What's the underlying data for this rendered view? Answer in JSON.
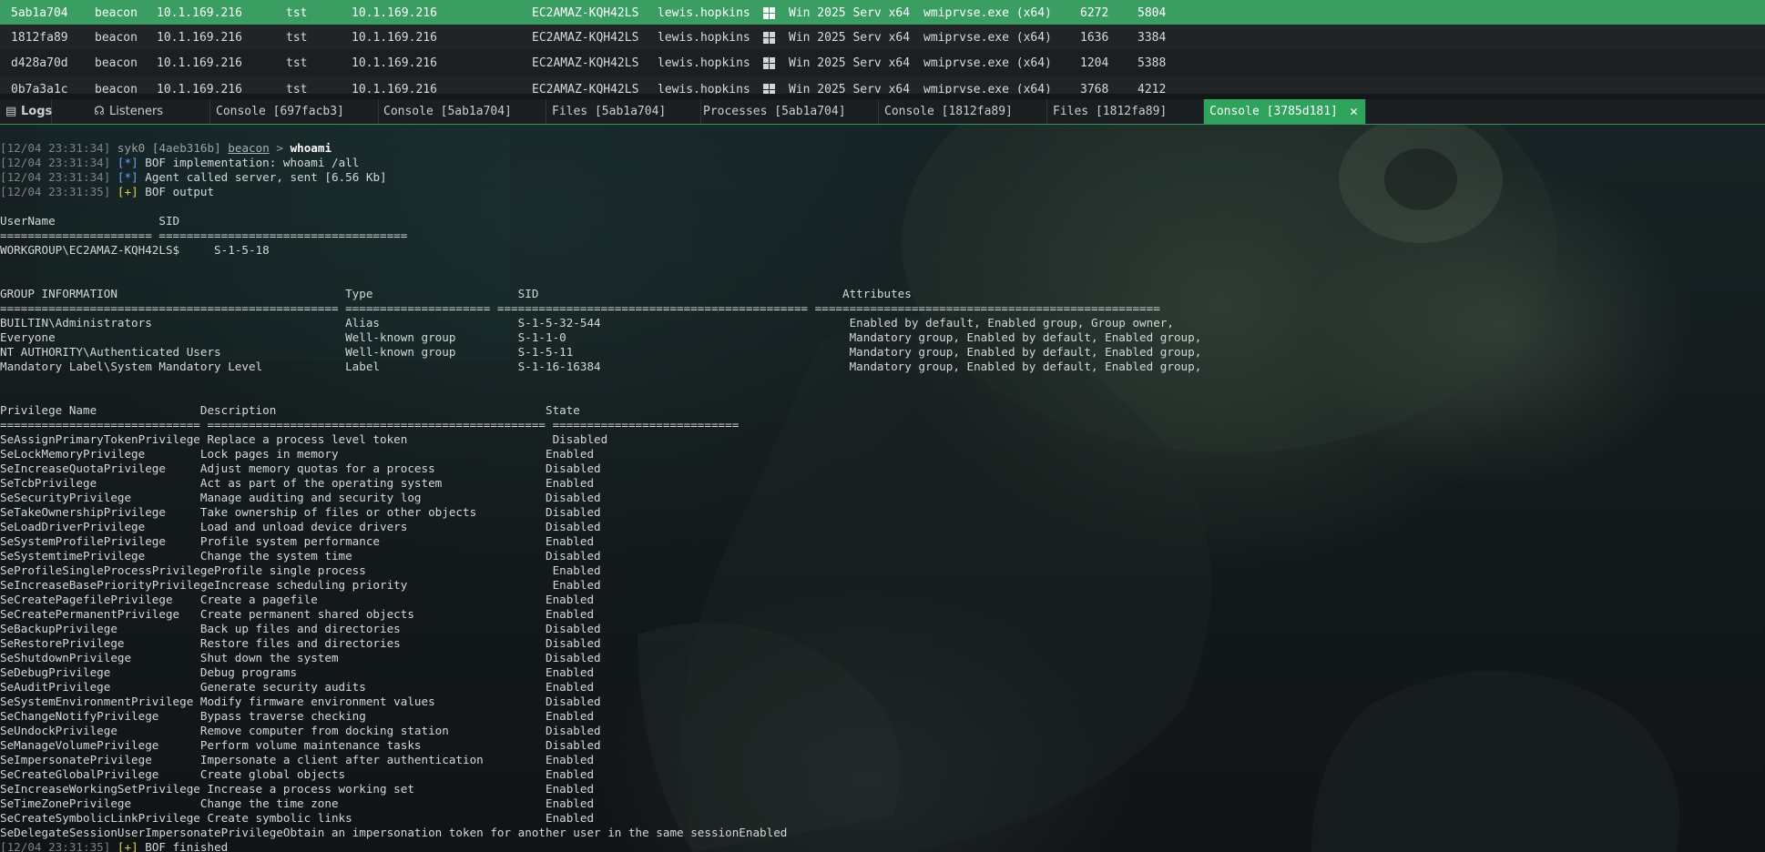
{
  "sessions": [
    {
      "id": "5ab1a704",
      "type": "beacon",
      "external": "10.1.169.216",
      "user": "tst",
      "internal": "10.1.169.216",
      "computer": "EC2AMAZ-KQH42LS",
      "username": "lewis.hopkins",
      "os_icon": "windows-icon",
      "os": "Win 2025 Serv x64",
      "process": "wmiprvse.exe (x64)",
      "pid": "6272",
      "tid": "5804",
      "selected": true
    },
    {
      "id": "1812fa89",
      "type": "beacon",
      "external": "10.1.169.216",
      "user": "tst",
      "internal": "10.1.169.216",
      "computer": "EC2AMAZ-KQH42LS",
      "username": "lewis.hopkins",
      "os_icon": "windows-icon",
      "os": "Win 2025 Serv x64",
      "process": "wmiprvse.exe (x64)",
      "pid": "1636",
      "tid": "3384",
      "selected": false
    },
    {
      "id": "d428a70d",
      "type": "beacon",
      "external": "10.1.169.216",
      "user": "tst",
      "internal": "10.1.169.216",
      "computer": "EC2AMAZ-KQH42LS",
      "username": "lewis.hopkins",
      "os_icon": "windows-icon",
      "os": "Win 2025 Serv x64",
      "process": "wmiprvse.exe (x64)",
      "pid": "1204",
      "tid": "5388",
      "selected": false
    },
    {
      "id": "0b7a3a1c",
      "type": "beacon",
      "external": "10.1.169.216",
      "user": "tst",
      "internal": "10.1.169.216",
      "computer": "EC2AMAZ-KQH42LS",
      "username": "lewis.hopkins",
      "os_icon": "windows-icon",
      "os": "Win 2025 Serv x64",
      "process": "wmiprvse.exe (x64)",
      "pid": "3768",
      "tid": "4212",
      "selected": false
    }
  ],
  "tabs": [
    {
      "label": "Logs",
      "icon": "document-icon",
      "active": false
    },
    {
      "label": "Listeners",
      "icon": "headphones-icon",
      "active": false
    },
    {
      "label": "Console [697facb3]",
      "active": false
    },
    {
      "label": "Console [5ab1a704]",
      "active": false
    },
    {
      "label": "Files [5ab1a704]",
      "active": false
    },
    {
      "label": "Processes [5ab1a704]",
      "active": false
    },
    {
      "label": "Console [1812fa89]",
      "active": false
    },
    {
      "label": "Files [1812fa89]",
      "active": false
    },
    {
      "label": "Console [3785d181]",
      "active": true,
      "close_icon": "close-icon"
    }
  ],
  "console": {
    "header": [
      {
        "ts": "[12/04 23:31:34]",
        "operator": "syk0",
        "session": "[4aeb316b]",
        "agent": "beacon",
        "arrow": ">",
        "command": "whoami"
      },
      {
        "ts": "[12/04 23:31:34]",
        "tag": "[*]",
        "text": "BOF implementation: whoami /all"
      },
      {
        "ts": "[12/04 23:31:34]",
        "tag": "[*]",
        "text": "Agent called server, sent [6.56 Kb]"
      },
      {
        "ts": "[12/04 23:31:35]",
        "tag": "[+]",
        "text": "BOF output"
      }
    ],
    "output": [
      "",
      "UserName               SID",
      "====================== ====================================",
      "WORKGROUP\\EC2AMAZ-KQH42LS$     S-1-5-18",
      "",
      "",
      "GROUP INFORMATION                                 Type                     SID                                            Attributes",
      "================================================= ===================== ============================================= ==================================================",
      "BUILTIN\\Administrators                            Alias                    S-1-5-32-544                                    Enabled by default, Enabled group, Group owner,",
      "Everyone                                          Well-known group         S-1-1-0                                         Mandatory group, Enabled by default, Enabled group,",
      "NT AUTHORITY\\Authenticated Users                  Well-known group         S-1-5-11                                        Mandatory group, Enabled by default, Enabled group,",
      "Mandatory Label\\System Mandatory Level            Label                    S-1-16-16384                                    Mandatory group, Enabled by default, Enabled group,",
      "",
      "",
      "Privilege Name               Description                                       State",
      "============================= ================================================= ===========================",
      "SeAssignPrimaryTokenPrivilege Replace a process level token                     Disabled",
      "SeLockMemoryPrivilege        Lock pages in memory                              Enabled",
      "SeIncreaseQuotaPrivilege     Adjust memory quotas for a process                Disabled",
      "SeTcbPrivilege               Act as part of the operating system               Enabled",
      "SeSecurityPrivilege          Manage auditing and security log                  Disabled",
      "SeTakeOwnershipPrivilege     Take ownership of files or other objects          Disabled",
      "SeLoadDriverPrivilege        Load and unload device drivers                    Disabled",
      "SeSystemProfilePrivilege     Profile system performance                        Enabled",
      "SeSystemtimePrivilege        Change the system time                            Disabled",
      "SeProfileSingleProcessPrivilegeProfile single process                           Enabled",
      "SeIncreaseBasePriorityPrivilegeIncrease scheduling priority                     Enabled",
      "SeCreatePagefilePrivilege    Create a pagefile                                 Enabled",
      "SeCreatePermanentPrivilege   Create permanent shared objects                   Enabled",
      "SeBackupPrivilege            Back up files and directories                     Disabled",
      "SeRestorePrivilege           Restore files and directories                     Disabled",
      "SeShutdownPrivilege          Shut down the system                              Disabled",
      "SeDebugPrivilege             Debug programs                                    Enabled",
      "SeAuditPrivilege             Generate security audits                          Enabled",
      "SeSystemEnvironmentPrivilege Modify firmware environment values                Disabled",
      "SeChangeNotifyPrivilege      Bypass traverse checking                          Enabled",
      "SeUndockPrivilege            Remove computer from docking station              Disabled",
      "SeManageVolumePrivilege      Perform volume maintenance tasks                  Disabled",
      "SeImpersonatePrivilege       Impersonate a client after authentication         Enabled",
      "SeCreateGlobalPrivilege      Create global objects                             Enabled",
      "SeIncreaseWorkingSetPrivilege Increase a process working set                   Enabled",
      "SeTimeZonePrivilege          Change the time zone                              Enabled",
      "SeCreateSymbolicLinkPrivilege Create symbolic links                            Enabled",
      "SeDelegateSessionUserImpersonatePrivilegeObtain an impersonation token for another user in the same sessionEnabled"
    ],
    "footer": {
      "ts": "[12/04 23:31:35]",
      "tag": "[+]",
      "text": "BOF finished"
    }
  },
  "colors": {
    "accent": "#2ea35c",
    "selected_row": "#3a9e63",
    "info_tag": "#6aa0ff",
    "ok_tag": "#e0cf52"
  }
}
